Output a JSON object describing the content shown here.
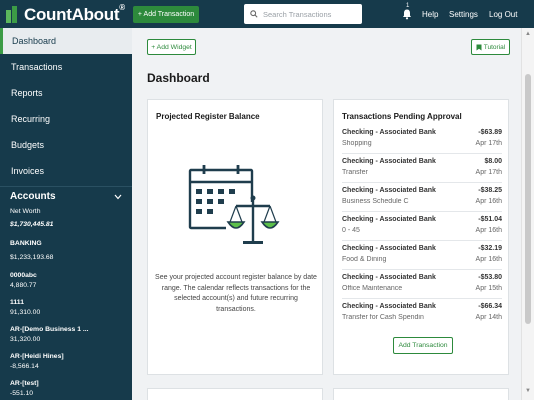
{
  "app": {
    "logo_text": "CountAbout",
    "logo_mark": "®",
    "add_transaction": "+ Add Transaction",
    "search_placeholder": "Search Transactions",
    "notification_count": "1",
    "help": "Help",
    "settings": "Settings",
    "logout": "Log Out"
  },
  "sidebar": {
    "nav": [
      "Dashboard",
      "Transactions",
      "Reports",
      "Recurring",
      "Budgets",
      "Invoices"
    ],
    "active": "Dashboard",
    "accounts_title": "Accounts",
    "net_worth_label": "Net Worth",
    "net_worth_value": "$1,730,445.81",
    "banking_label": "BANKING",
    "banking_value": "$1,233,193.68",
    "accounts": [
      {
        "name": "0000abc",
        "value": "4,880.77"
      },
      {
        "name": "1111",
        "value": "91,310.00"
      },
      {
        "name": "AR-[Demo Business 1 ...",
        "value": "31,320.00"
      },
      {
        "name": "AR-[Heidi Hines]",
        "value": "-8,566.14"
      },
      {
        "name": "AR-[test]",
        "value": "-551.10"
      }
    ]
  },
  "main": {
    "add_widget": "+ Add Widget",
    "tutorial": "Tutorial",
    "title": "Dashboard",
    "register_card": {
      "title": "Projected Register Balance",
      "description": "See your projected account register balance by date range. The calendar reflects transactions for the selected account(s) and future recurring transactions."
    },
    "pending_card": {
      "title": "Transactions Pending Approval",
      "rows": [
        {
          "account": "Checking - Associated Bank",
          "amount": "-$63.89",
          "category": "Shopping",
          "date": "Apr 17th"
        },
        {
          "account": "Checking - Associated Bank",
          "amount": "$8.00",
          "category": "Transfer",
          "date": "Apr 17th"
        },
        {
          "account": "Checking - Associated Bank",
          "amount": "-$38.25",
          "category": "Business Schedule C",
          "date": "Apr 16th"
        },
        {
          "account": "Checking - Associated Bank",
          "amount": "-$51.04",
          "category": "0 - 45",
          "date": "Apr 16th"
        },
        {
          "account": "Checking - Associated Bank",
          "amount": "-$32.19",
          "category": "Food & Dining",
          "date": "Apr 16th"
        },
        {
          "account": "Checking - Associated Bank",
          "amount": "-$53.80",
          "category": "Office Maintenance",
          "date": "Apr 15th"
        },
        {
          "account": "Checking - Associated Bank",
          "amount": "-$66.34",
          "category": "Transfer for Cash Spendin",
          "date": "Apr 14th"
        }
      ],
      "add_button": "Add Transaction"
    }
  },
  "colors": {
    "navy": "#163a4b",
    "green": "#2d8a3c",
    "illustration_dark": "#1f3d4d",
    "illustration_green": "#5cbf4a"
  }
}
